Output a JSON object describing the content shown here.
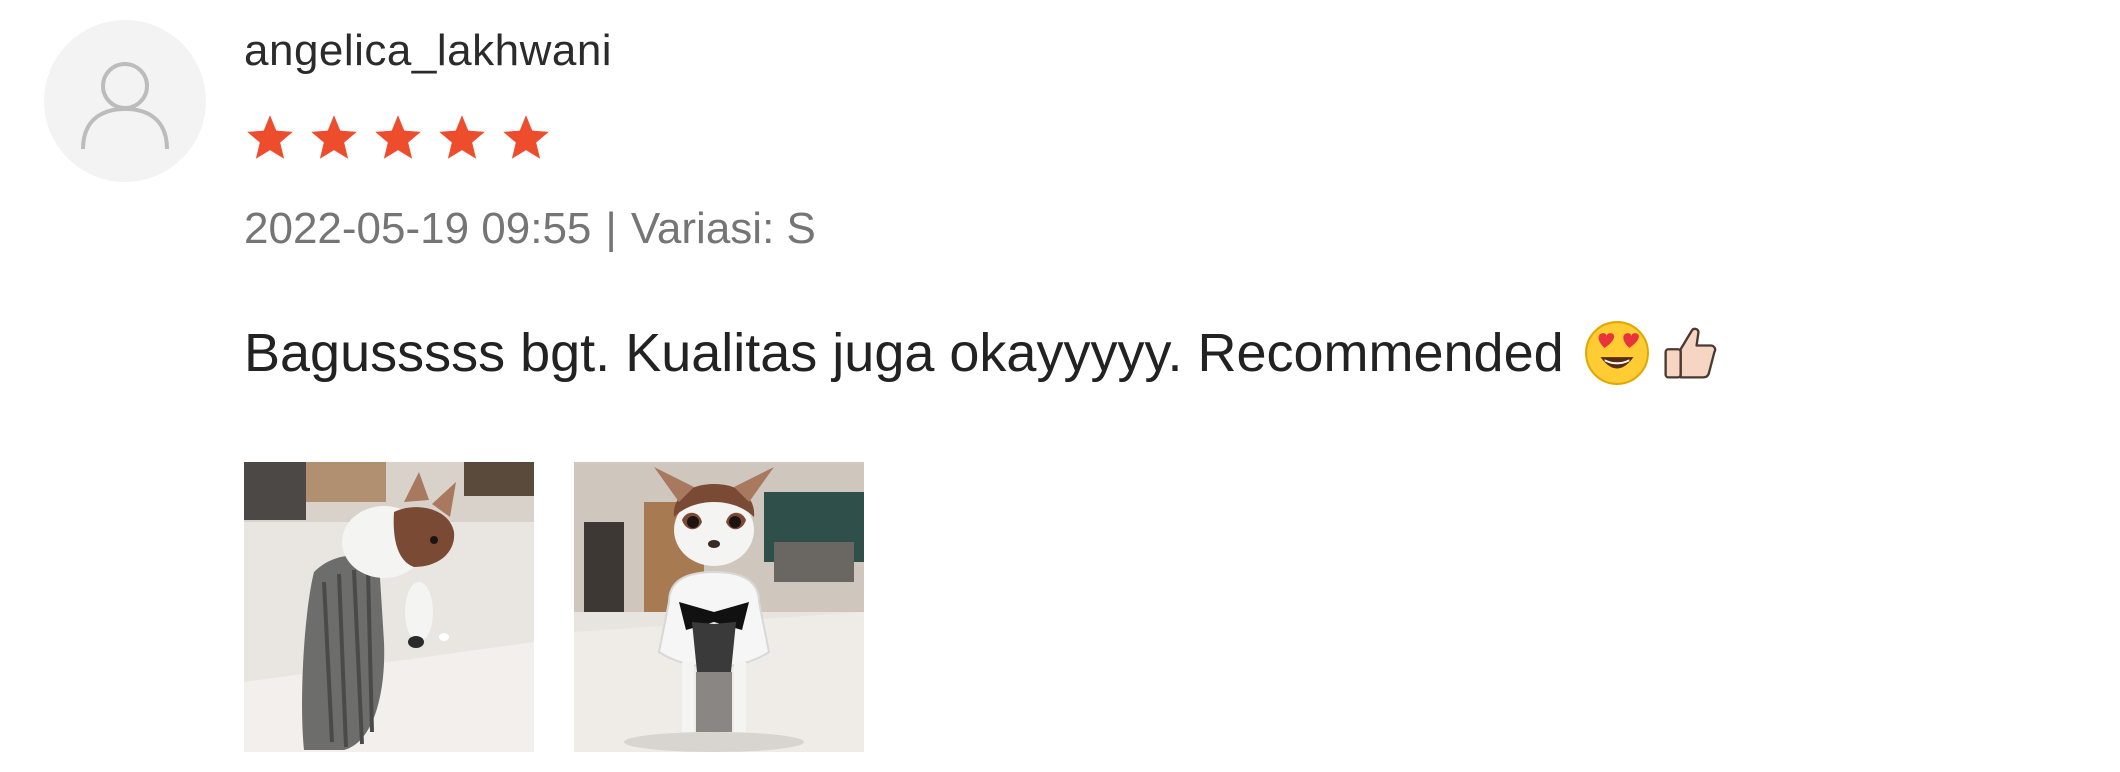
{
  "review": {
    "username": "angelica_lakhwani",
    "rating": 5,
    "rating_max": 5,
    "date": "2022-05-19 09:55",
    "separator": "|",
    "variant": "Variasi: S",
    "comment": "Bagusssss bgt. Kualitas juga okayyyyy. Recommended",
    "comment_emojis": [
      "heart-eyes-emoji",
      "thumbs-up-emoji"
    ],
    "star_color": "#ee4d2d",
    "photos": [
      {
        "name": "review-photo-1"
      },
      {
        "name": "review-photo-2"
      }
    ]
  }
}
